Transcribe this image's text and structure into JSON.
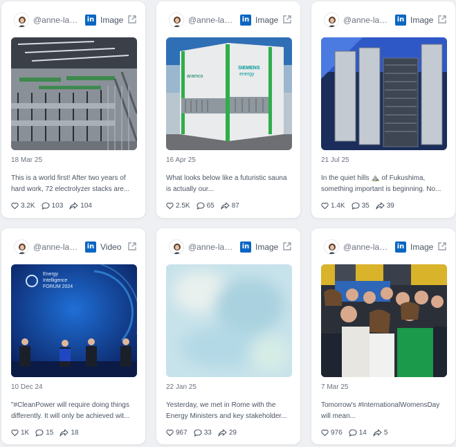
{
  "accent": "#0a66c2",
  "cards": [
    {
      "author": "@anne-laure...",
      "platform": "linkedin",
      "type": "Image",
      "date": "18 Mar 25",
      "text": "This is a world first! After two years of hard work, 72 electrolyzer stacks are...",
      "likes": "3.2K",
      "comments": "103",
      "shares": "104",
      "image": "electrolyzer hall"
    },
    {
      "author": "@anne-laure...",
      "platform": "linkedin",
      "type": "Image",
      "date": "16 Apr 25",
      "text": "What looks below like a futuristic sauna is actually our...",
      "likes": "2.5K",
      "comments": "65",
      "shares": "87",
      "image": "aramco siemens energy module",
      "logo_left": "aramco",
      "logo_right": "SIEMENS energy"
    },
    {
      "author": "@anne-laure...",
      "platform": "linkedin",
      "type": "Image",
      "date": "21 Jul 25",
      "text": "In the quiet hills ⛰️ of Fukushima, something important is beginning. No...",
      "likes": "1.4K",
      "comments": "35",
      "shares": "39",
      "image": "stacked plates"
    },
    {
      "author": "@anne-laure...",
      "platform": "linkedin",
      "type": "Video",
      "date": "10 Dec 24",
      "text": "\"#CleanPower will require doing things differently. It will only be achieved wit...",
      "likes": "1K",
      "comments": "15",
      "shares": "18",
      "image": "forum panel",
      "forum_title": "Energy Intelligence FORUM 2024"
    },
    {
      "author": "@anne-laure...",
      "platform": "linkedin",
      "type": "Image",
      "date": "22 Jan 25",
      "text": "Yesterday, we met in Rome with the Energy Ministers and key stakeholder...",
      "likes": "967",
      "comments": "33",
      "shares": "29",
      "image": "blurred"
    },
    {
      "author": "@anne-laure...",
      "platform": "linkedin",
      "type": "Image",
      "date": "7 Mar 25",
      "text": "Tomorrow's #InternationalWomensDay will mean...",
      "likes": "976",
      "comments": "14",
      "shares": "5",
      "image": "group selfie"
    }
  ]
}
